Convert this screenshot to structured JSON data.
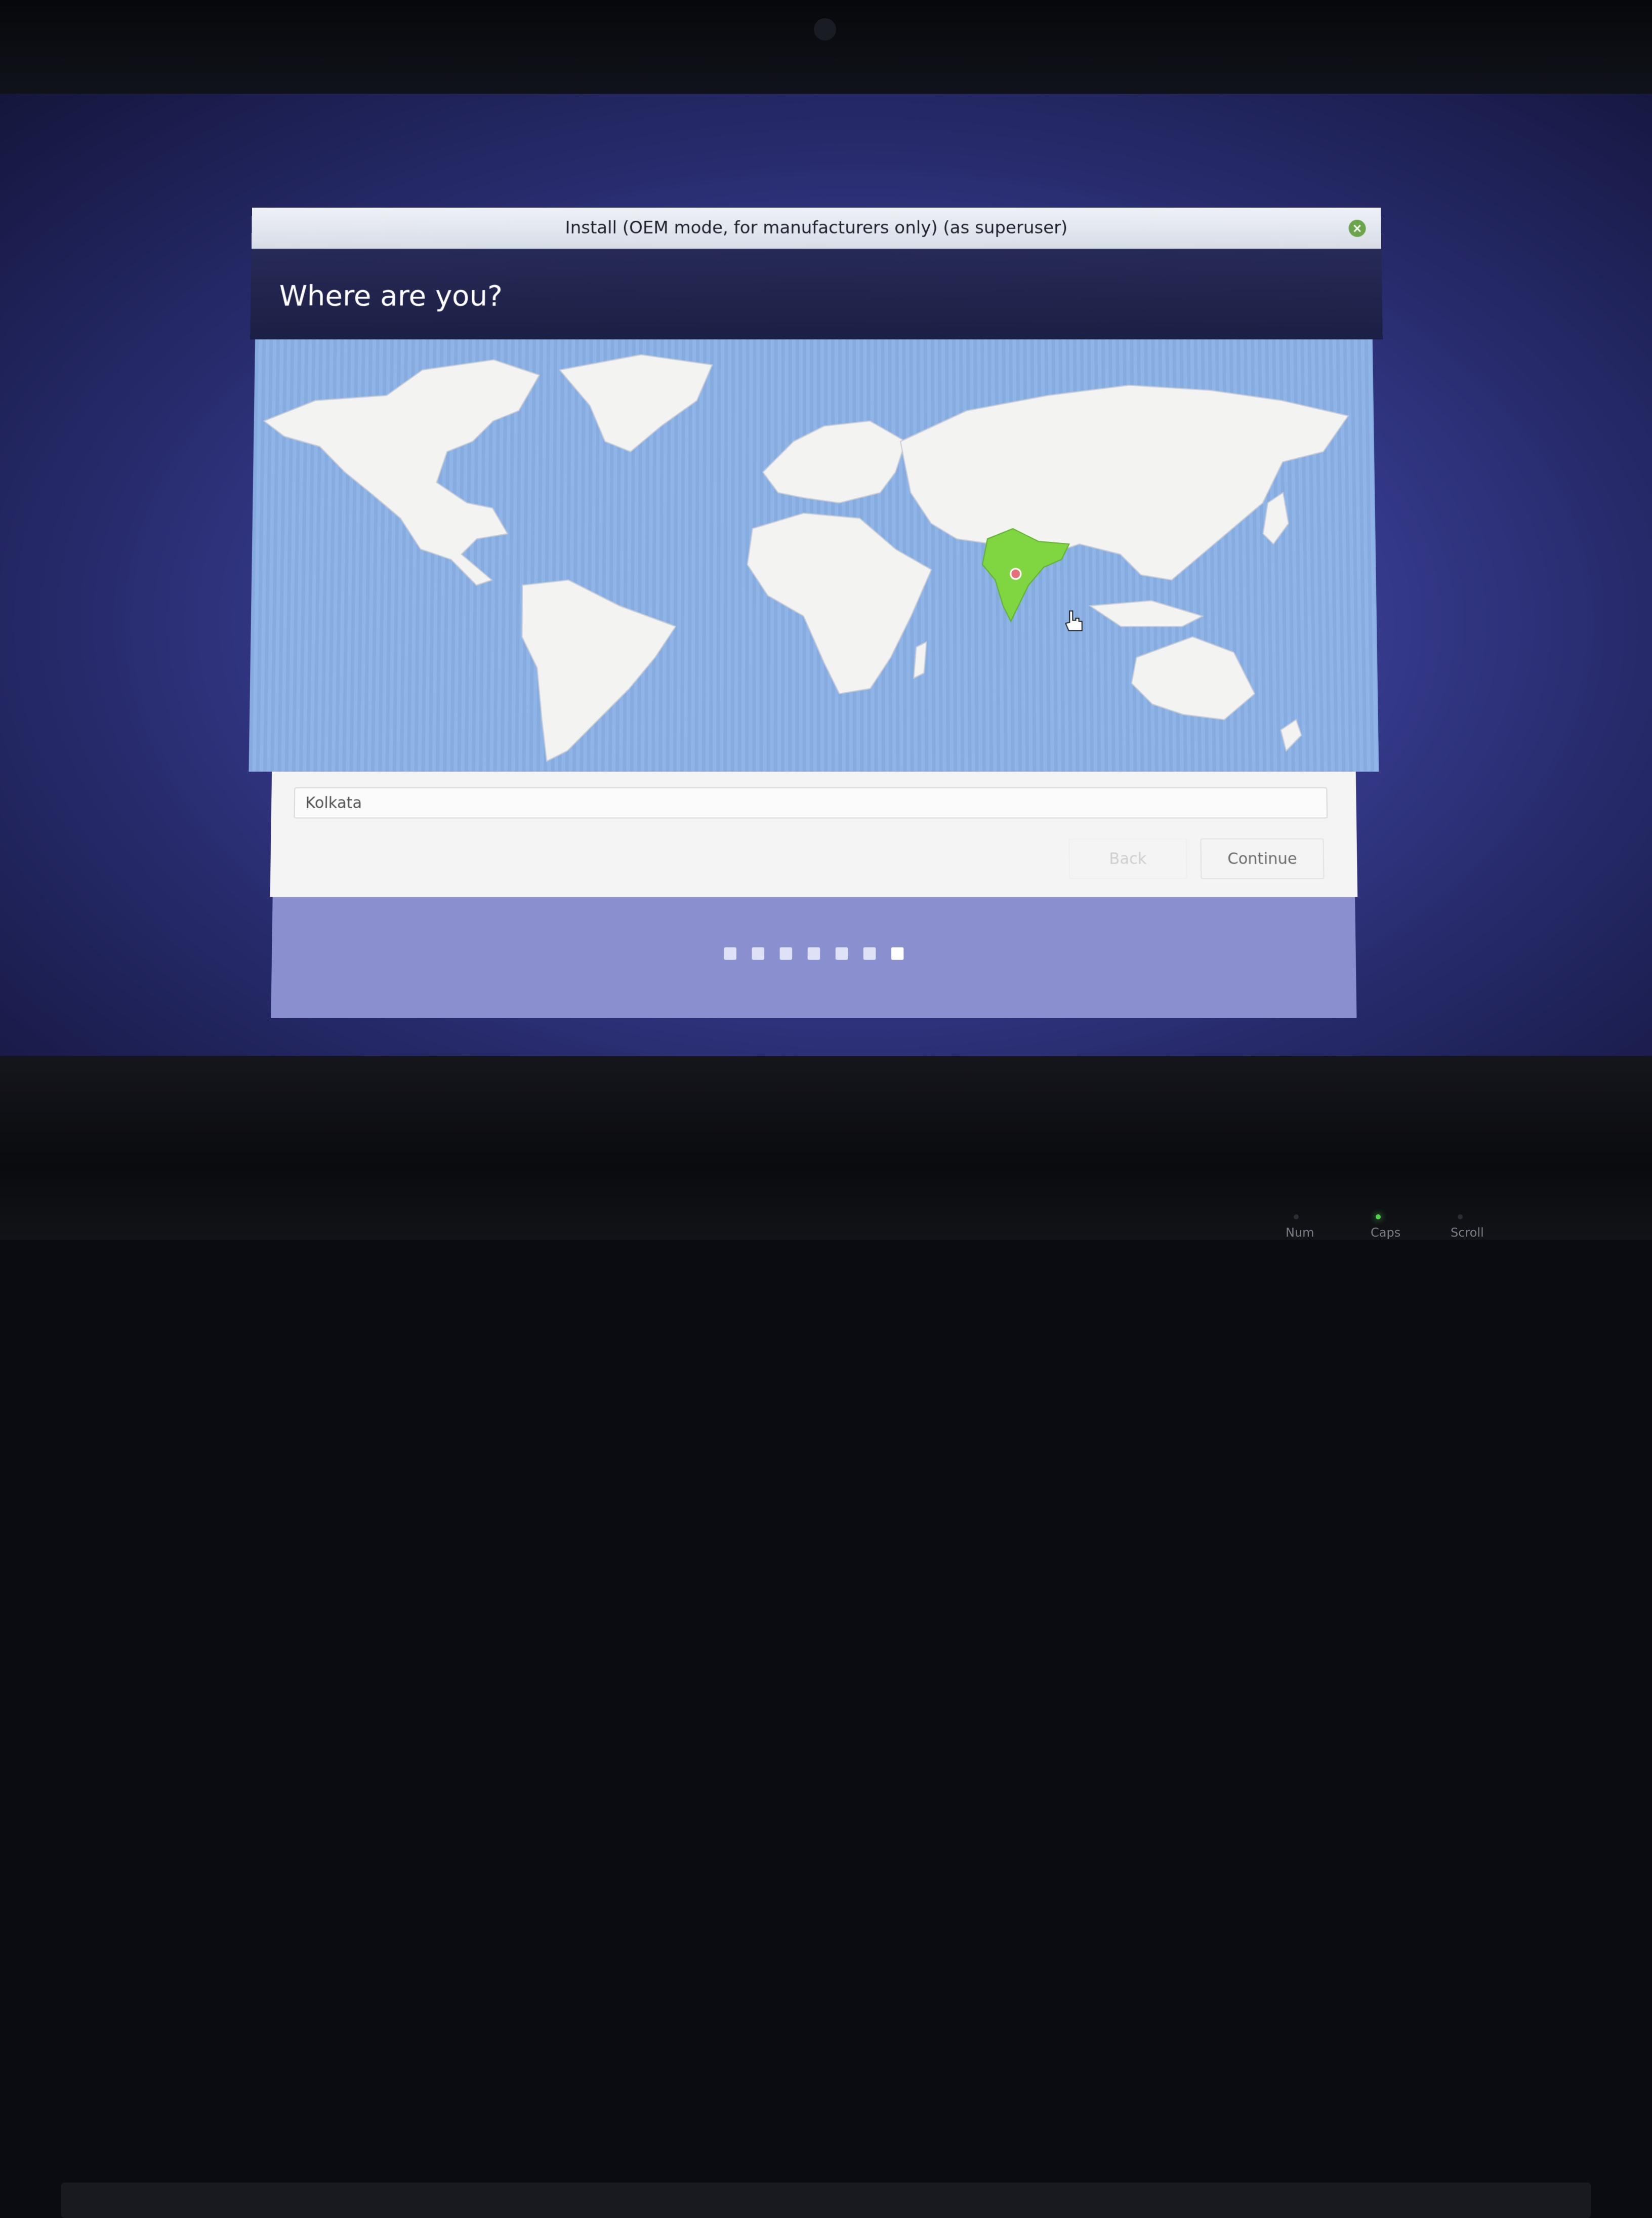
{
  "window": {
    "title": "Install (OEM mode, for manufacturers only) (as superuser)",
    "close_icon": "×"
  },
  "page": {
    "heading": "Where are you?"
  },
  "map": {
    "highlighted_region": "India",
    "marker": "Kolkata"
  },
  "location": {
    "value": "Kolkata"
  },
  "buttons": {
    "back": "Back",
    "continue": "Continue"
  },
  "progress": {
    "total_steps": 7,
    "active_step": 7
  },
  "keyboard_leds": {
    "num": "Num",
    "caps": "Caps",
    "scroll": "Scroll"
  },
  "colors": {
    "header": "#262a56",
    "ocean": "#8fb5e8",
    "land": "#f3f4f2",
    "highlight": "#7fd640",
    "progress_bg": "#8a90cf"
  }
}
